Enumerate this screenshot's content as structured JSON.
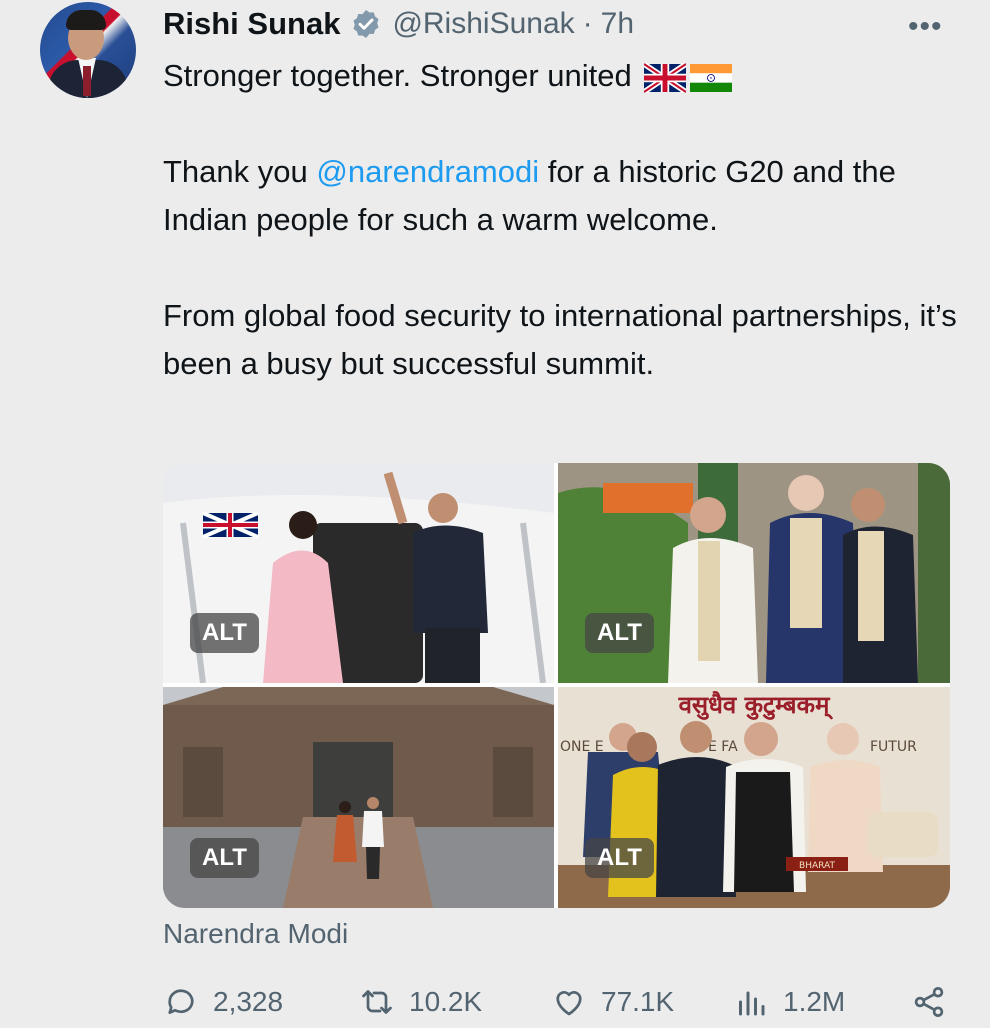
{
  "author": {
    "name": "Rishi Sunak",
    "handle": "@RishiSunak",
    "separator": "·",
    "time": "7h"
  },
  "more_label": "•••",
  "body": {
    "line1": "Stronger together. Stronger united",
    "para2_before": "Thank you ",
    "mention": "@narendramodi",
    "para2_after": " for a historic G20 and the Indian people for such a warm welcome.",
    "para3": "From global food security to international partnerships, it’s been a busy but successful summit."
  },
  "media": [
    {
      "alt_label": "ALT"
    },
    {
      "alt_label": "ALT"
    },
    {
      "alt_label": "ALT"
    },
    {
      "alt_label": "ALT"
    }
  ],
  "photo_text": {
    "banner_top": "वसुधैव कुटुम्बकम्",
    "banner_left": "ONE E",
    "banner_mid": "E FA",
    "banner_right": "FUTUR",
    "nameplate": "BHARAT"
  },
  "caption": "Narendra Modi",
  "stats": {
    "replies": "2,328",
    "retweets": "10.2K",
    "likes": "77.1K",
    "views": "1.2M"
  },
  "icons": [
    "verified-badge-icon",
    "uk-flag-icon",
    "india-flag-icon",
    "reply-icon",
    "retweet-icon",
    "like-icon",
    "views-icon",
    "share-icon"
  ],
  "colors": {
    "accent": "#1d9bf0",
    "secondary_text": "#536471",
    "verified": "#829aab"
  }
}
